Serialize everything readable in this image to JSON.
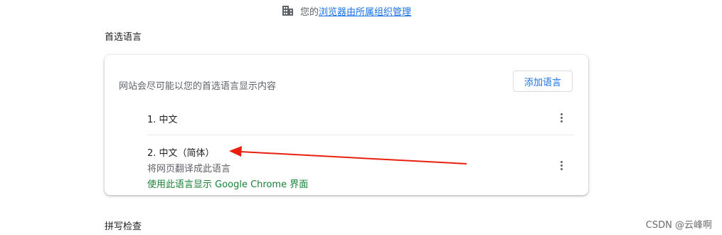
{
  "managed_notice": {
    "prefix": "您的",
    "link": "浏览器由所属组织管理",
    "icon": "building-icon"
  },
  "preferred_languages": {
    "title": "首选语言",
    "description": "网站会尽可能以您的首选语言显示内容",
    "add_button": "添加语言",
    "items": [
      {
        "label": "1. 中文"
      },
      {
        "label": "2. 中文（简体）",
        "subtitle": "将网页翻译成此语言",
        "ui_note": "使用此语言显示 Google Chrome 界面"
      }
    ]
  },
  "spellcheck": {
    "title": "拼写检查"
  },
  "annotation": {
    "arrow_color": "#e8210f"
  },
  "watermark": "CSDN @云峰啊"
}
